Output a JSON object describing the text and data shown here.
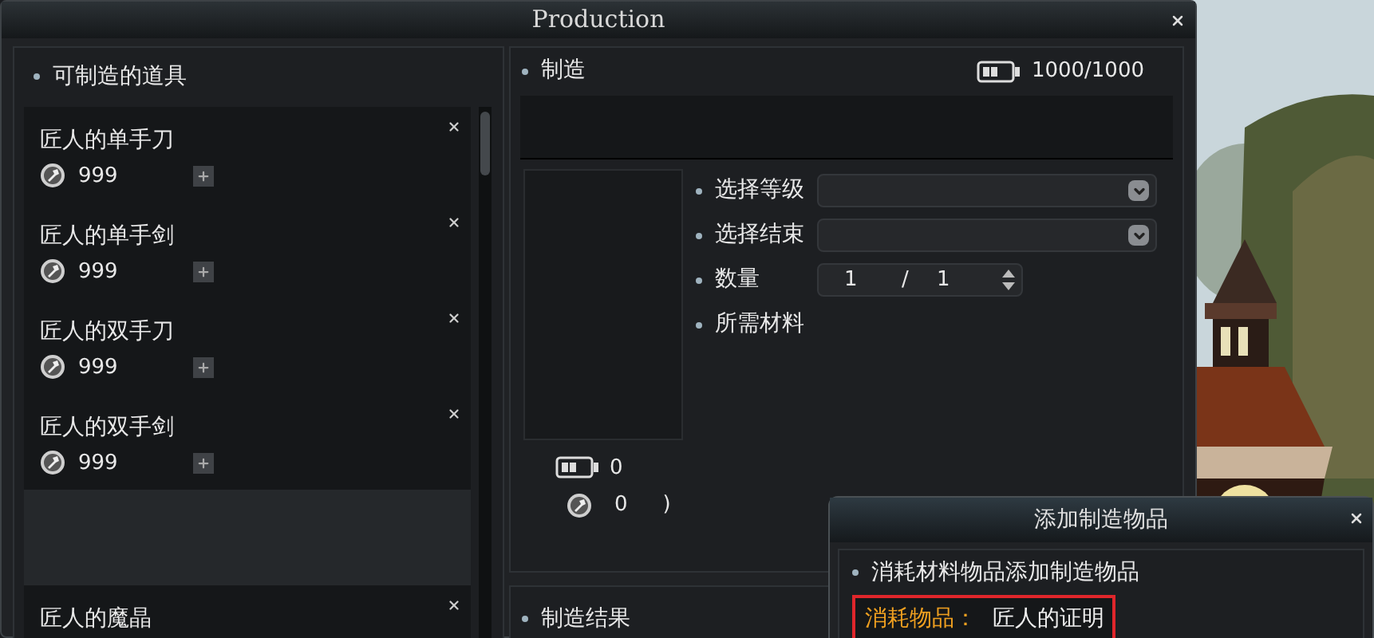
{
  "window": {
    "title": "Production"
  },
  "craftable_items": {
    "title": "可制造的道具",
    "items": [
      {
        "name": "匠人的单手刀",
        "count": "999"
      },
      {
        "name": "匠人的单手剑",
        "count": "999"
      },
      {
        "name": "匠人的双手刀",
        "count": "999"
      },
      {
        "name": "匠人的双手剑",
        "count": "999"
      },
      {
        "name": "匠人的魔晶"
      }
    ]
  },
  "production": {
    "title": "制造",
    "energy": "1000/1000",
    "fields": [
      {
        "kind": "dropdown",
        "label": "选择等级"
      },
      {
        "kind": "dropdown",
        "label": "选择结束"
      },
      {
        "kind": "quantity",
        "label": "数量",
        "value": "1",
        "separator": "/",
        "max": "1"
      },
      {
        "kind": "text",
        "label": "所需材料"
      }
    ],
    "energy_cost": "0",
    "gold_cost": "0",
    "bracket": ")"
  },
  "result": {
    "title": "制造结果"
  },
  "dialog": {
    "title": "添加制造物品",
    "subtitle": "消耗材料物品添加制造物品",
    "consume_label": "消耗物品：",
    "consume_value": "匠人的证明"
  }
}
